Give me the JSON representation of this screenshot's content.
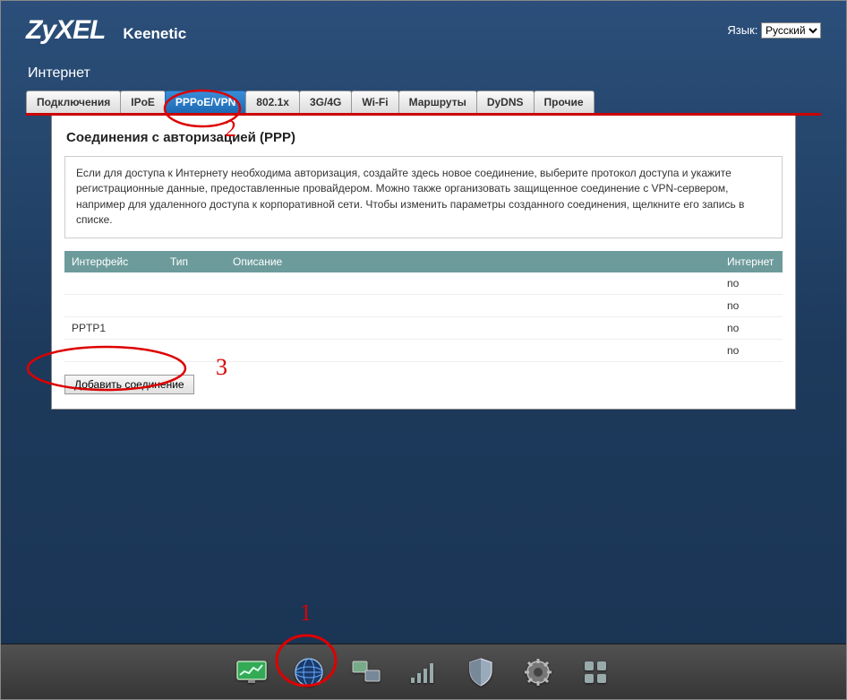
{
  "header": {
    "logo": "ZyXEL",
    "model": "Keenetic",
    "lang_label": "Язык:",
    "lang_value": "Русский"
  },
  "section_title": "Интернет",
  "tabs": [
    {
      "label": "Подключения",
      "active": false
    },
    {
      "label": "IPoE",
      "active": false
    },
    {
      "label": "PPPoE/VPN",
      "active": true
    },
    {
      "label": "802.1x",
      "active": false
    },
    {
      "label": "3G/4G",
      "active": false
    },
    {
      "label": "Wi-Fi",
      "active": false
    },
    {
      "label": "Маршруты",
      "active": false
    },
    {
      "label": "DyDNS",
      "active": false
    },
    {
      "label": "Прочие",
      "active": false
    }
  ],
  "panel": {
    "heading": "Соединения с авторизацией (PPP)",
    "infobox": "Если для доступа к Интернету необходима авторизация, создайте здесь новое соединение, выберите протокол доступа и укажите регистрационные данные, предоставленные провайдером. Можно также организовать защищенное соединение с VPN-сервером, например для удаленного доступа к корпоративной сети. Чтобы изменить параметры созданного соединения, щелкните его запись в списке.",
    "columns": {
      "interface": "Интерфейс",
      "type": "Тип",
      "description": "Описание",
      "internet": "Интернет"
    },
    "rows": [
      {
        "interface": "",
        "type": "",
        "description": "",
        "internet": "no"
      },
      {
        "interface": "",
        "type": "",
        "description": "",
        "internet": "no"
      },
      {
        "interface": "PPTP1",
        "type": "",
        "description": "",
        "internet": "no"
      },
      {
        "interface": "",
        "type": "",
        "description": "",
        "internet": "no"
      }
    ],
    "add_button": "Добавить соединение"
  },
  "bottom_nav": [
    {
      "name": "monitor-icon"
    },
    {
      "name": "globe-icon"
    },
    {
      "name": "network-icon"
    },
    {
      "name": "signal-icon"
    },
    {
      "name": "shield-icon"
    },
    {
      "name": "gear-icon"
    },
    {
      "name": "apps-icon"
    }
  ],
  "annotations": {
    "num1": "1",
    "num2": "2",
    "num3": "3"
  }
}
